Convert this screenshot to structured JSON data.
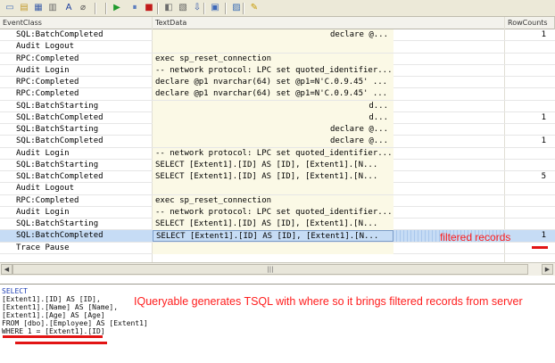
{
  "toolbar": {
    "buttons": [
      {
        "name": "new-trace-icon",
        "glyph": "▭",
        "color": "#4a72b8"
      },
      {
        "name": "open-icon",
        "glyph": "▤",
        "color": "#c29a2c"
      },
      {
        "name": "save-icon",
        "glyph": "▦",
        "color": "#3c5ea8"
      },
      {
        "name": "properties-icon",
        "glyph": "▥",
        "color": "#6a6a6a"
      },
      {
        "name": "find-icon",
        "glyph": "A",
        "color": "#1d3f9e"
      },
      {
        "name": "clear-icon",
        "glyph": "⌀",
        "color": "#555555"
      },
      {
        "name": "run-icon",
        "glyph": "▶",
        "color": "#1f9a2c"
      },
      {
        "name": "pause-icon",
        "glyph": "⏸",
        "color": "#2a57b5"
      },
      {
        "name": "stop-icon",
        "glyph": "■",
        "color": "#c21a1a"
      },
      {
        "name": "template-icon",
        "glyph": "◧",
        "color": "#6d6d6d"
      },
      {
        "name": "columns-icon",
        "glyph": "▧",
        "color": "#5a5a5a"
      },
      {
        "name": "scroll-icon",
        "glyph": "⇩",
        "color": "#2f54a8"
      },
      {
        "name": "events-icon",
        "glyph": "▣",
        "color": "#3d68b8"
      },
      {
        "name": "settings-icon",
        "glyph": "▨",
        "color": "#3a6db5"
      },
      {
        "name": "help-icon",
        "glyph": "✎",
        "color": "#c79a00"
      }
    ]
  },
  "grid": {
    "columns": {
      "event_class": "EventClass",
      "text_data": "TextData",
      "row_counts": "RowCounts"
    },
    "rows": [
      {
        "event": "SQL:BatchCompleted",
        "text": "declare @...",
        "align": "right",
        "count": "1",
        "selected": false
      },
      {
        "event": "Audit Logout",
        "text": "",
        "align": "left",
        "count": "",
        "selected": false
      },
      {
        "event": "RPC:Completed",
        "text": "exec sp_reset_connection",
        "align": "left",
        "count": "",
        "selected": false
      },
      {
        "event": "Audit Login",
        "text": "-- network protocol: LPC  set quoted_identifier...",
        "align": "left",
        "count": "",
        "selected": false
      },
      {
        "event": "RPC:Completed",
        "text": "declare @p1 nvarchar(64)  set @p1=N'C.0.9.45'  ...",
        "align": "left",
        "count": "",
        "selected": false
      },
      {
        "event": "RPC:Completed",
        "text": "declare @p1 nvarchar(64)  set @p1=N'C.0.9.45'  ...",
        "align": "left",
        "count": "",
        "selected": false
      },
      {
        "event": "SQL:BatchStarting",
        "text": "d...",
        "align": "right",
        "count": "",
        "selected": false
      },
      {
        "event": "SQL:BatchCompleted",
        "text": "d...",
        "align": "right",
        "count": "1",
        "selected": false
      },
      {
        "event": "SQL:BatchStarting",
        "text": "declare @...",
        "align": "right",
        "count": "",
        "selected": false
      },
      {
        "event": "SQL:BatchCompleted",
        "text": "declare @...",
        "align": "right",
        "count": "1",
        "selected": false
      },
      {
        "event": "Audit Login",
        "text": "-- network protocol: LPC  set quoted_identifier...",
        "align": "left",
        "count": "",
        "selected": false
      },
      {
        "event": "SQL:BatchStarting",
        "text": "SELECT   [Extent1].[ID] AS [ID],   [Extent1].[N...",
        "align": "left",
        "count": "",
        "selected": false
      },
      {
        "event": "SQL:BatchCompleted",
        "text": "SELECT   [Extent1].[ID] AS [ID],   [Extent1].[N...",
        "align": "left",
        "count": "5",
        "selected": false
      },
      {
        "event": "Audit Logout",
        "text": "",
        "align": "left",
        "count": "",
        "selected": false
      },
      {
        "event": "RPC:Completed",
        "text": "exec sp_reset_connection",
        "align": "left",
        "count": "",
        "selected": false
      },
      {
        "event": "Audit Login",
        "text": "-- network protocol: LPC  set quoted_identifier...",
        "align": "left",
        "count": "",
        "selected": false
      },
      {
        "event": "SQL:BatchStarting",
        "text": "SELECT   [Extent1].[ID] AS [ID],   [Extent1].[N...",
        "align": "left",
        "count": "",
        "selected": false
      },
      {
        "event": "SQL:BatchCompleted",
        "text": "SELECT   [Extent1].[ID] AS [ID],   [Extent1].[N...",
        "align": "left",
        "count": "1",
        "selected": true
      },
      {
        "event": "Trace Pause",
        "text": "",
        "align": "left",
        "count": "",
        "selected": false
      }
    ]
  },
  "scroll": {
    "grip": "|||"
  },
  "sql": {
    "lines": [
      "SELECT",
      "[Extent1].[ID] AS [ID],",
      "[Extent1].[Name] AS [Name],",
      "[Extent1].[Age] AS [Age]",
      "FROM [dbo].[Employee] AS [Extent1]",
      "WHERE 1 = [Extent1].[ID]"
    ]
  },
  "annotations": {
    "filtered": "filtered records",
    "explanation": "IQueryable generates TSQL with where so it brings filtered records from server",
    "color": "#ff1d1d"
  }
}
